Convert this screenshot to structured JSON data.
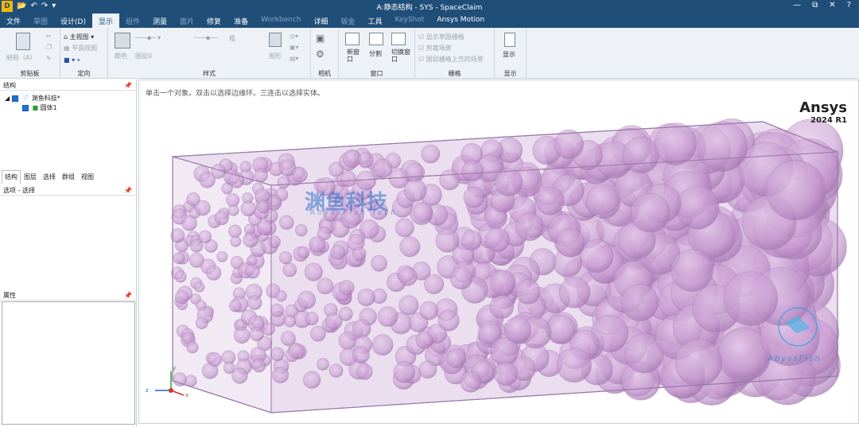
{
  "window": {
    "title": "A:静态结构 - SYS - SpaceClaim",
    "logo": "D",
    "controls": [
      "—",
      "⧉",
      "✕",
      "?"
    ]
  },
  "menu": {
    "tabs": [
      {
        "label": "文件",
        "state": "normal"
      },
      {
        "label": "草图",
        "state": "dim"
      },
      {
        "label": "设计(D)",
        "state": "normal"
      },
      {
        "label": "显示",
        "state": "active"
      },
      {
        "label": "组件",
        "state": "dim"
      },
      {
        "label": "测量",
        "state": "normal"
      },
      {
        "label": "面片",
        "state": "dim"
      },
      {
        "label": "修复",
        "state": "normal"
      },
      {
        "label": "准备",
        "state": "normal"
      },
      {
        "label": "Workbench",
        "state": "dim"
      },
      {
        "label": "详细",
        "state": "normal"
      },
      {
        "label": "钣金",
        "state": "dim"
      },
      {
        "label": "工具",
        "state": "normal"
      },
      {
        "label": "KeyShot",
        "state": "dim"
      },
      {
        "label": "Ansys Motion",
        "state": "normal"
      }
    ]
  },
  "ribbon": {
    "clipboard": {
      "label": "剪贴板",
      "paste": "粘贴（A）"
    },
    "orient": {
      "label": "定向",
      "home": "主视图",
      "plane": "平面视图"
    },
    "style": {
      "label": "样式",
      "color": "颜色",
      "layer": "图层0",
      "thick": "粗",
      "section": "图形"
    },
    "camera": {
      "label": "相机"
    },
    "window": {
      "label": "窗口",
      "new": "新窗口",
      "split": "分割",
      "switch": "切换窗口"
    },
    "grid": {
      "label": "栅格",
      "opt1": "显示草图栅格",
      "opt2": "剪裁场景",
      "opt3": "图层栅格上方的场景"
    },
    "display": {
      "label": "显示",
      "btn": "显示"
    }
  },
  "left_panel": {
    "structure_title": "结构",
    "tree_root": "渊鱼科技*",
    "tree_child": "圆体1",
    "tabs": [
      "结构",
      "图层",
      "选择",
      "群组",
      "视图"
    ],
    "options_title": "选项 - 选择",
    "properties_title": "属性"
  },
  "viewport": {
    "hint": "单击一个对象。双击以选择边缘环。三连击以选择实体。",
    "brand": "Ansys",
    "version": "2024 R1",
    "watermark": "渊鱼科技",
    "watermark_sub": "AbyssFish Tech",
    "watermark_logo_text": "AbyssFish",
    "axes": {
      "y": "y",
      "z": "z",
      "x": "x"
    }
  },
  "colors": {
    "titlebar": "#1f4e79",
    "ribbon": "#eef2f7",
    "particle_fill": "#c8a0d0",
    "box_edge": "#9a78a8"
  }
}
